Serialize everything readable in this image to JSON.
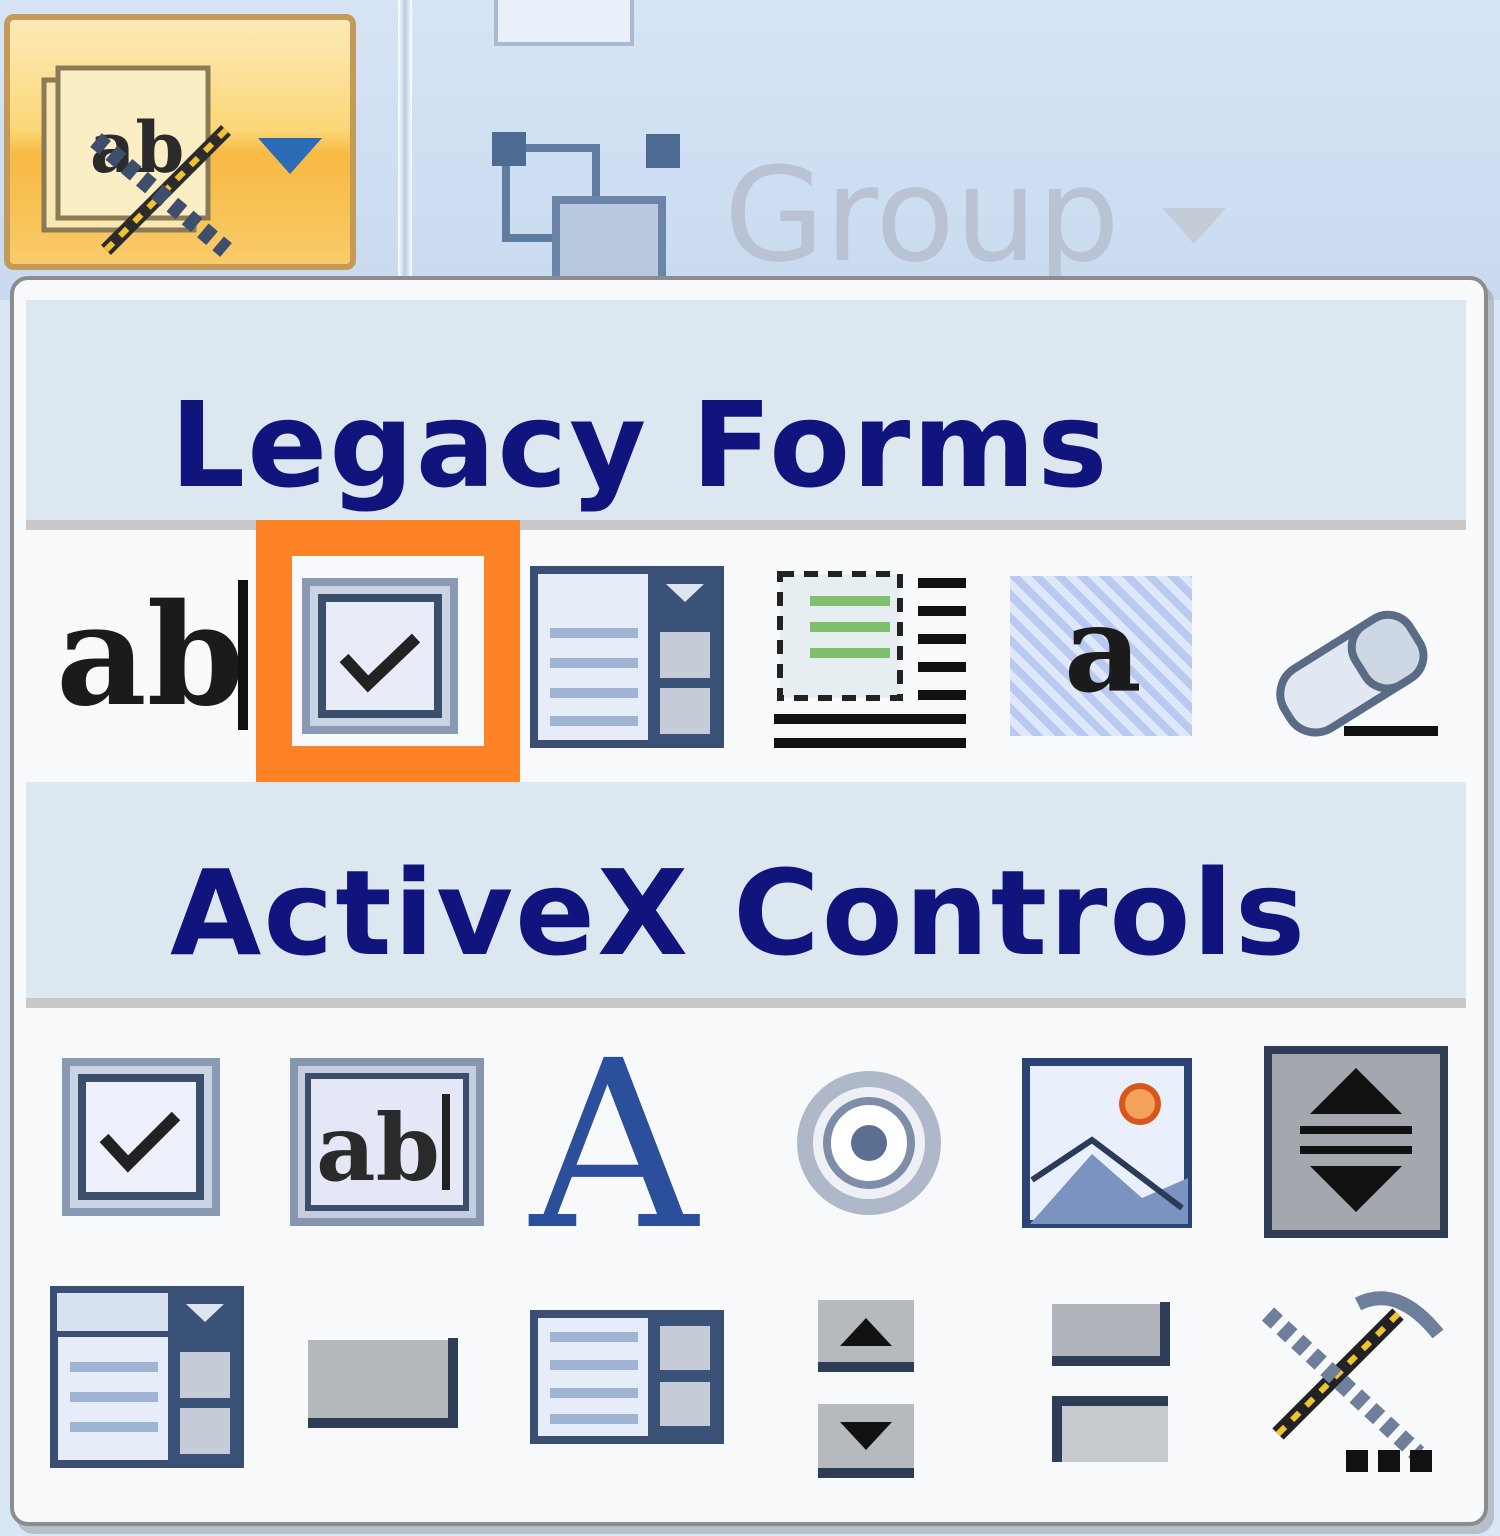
{
  "ribbon": {
    "group_label": "Group"
  },
  "panel": {
    "legacy_section_title": "Legacy Forms",
    "activex_section_title": "ActiveX Controls",
    "legacy_controls": [
      {
        "icon": "text-form-field-icon",
        "label": "ab"
      },
      {
        "icon": "check-box-form-field-icon"
      },
      {
        "icon": "drop-down-form-field-icon"
      },
      {
        "icon": "insert-frame-icon"
      },
      {
        "icon": "form-field-shading-icon",
        "label": "a"
      },
      {
        "icon": "reset-form-fields-icon"
      }
    ],
    "activex_controls_row1": [
      {
        "icon": "activex-check-box-icon"
      },
      {
        "icon": "activex-text-box-icon",
        "label": "ab"
      },
      {
        "icon": "activex-label-icon",
        "label": "A"
      },
      {
        "icon": "activex-option-button-icon"
      },
      {
        "icon": "activex-image-icon"
      },
      {
        "icon": "activex-scroll-bar-icon"
      }
    ],
    "activex_controls_row2": [
      {
        "icon": "activex-combo-box-icon"
      },
      {
        "icon": "activex-command-button-icon"
      },
      {
        "icon": "activex-list-box-icon"
      },
      {
        "icon": "activex-spin-button-icon"
      },
      {
        "icon": "activex-toggle-button-icon"
      },
      {
        "icon": "more-controls-icon"
      }
    ],
    "selected_control": "check-box-form-field-icon"
  },
  "colors": {
    "highlight": "#fd8125",
    "section_title": "#12147e",
    "section_header_bg": "#dde7f0"
  }
}
